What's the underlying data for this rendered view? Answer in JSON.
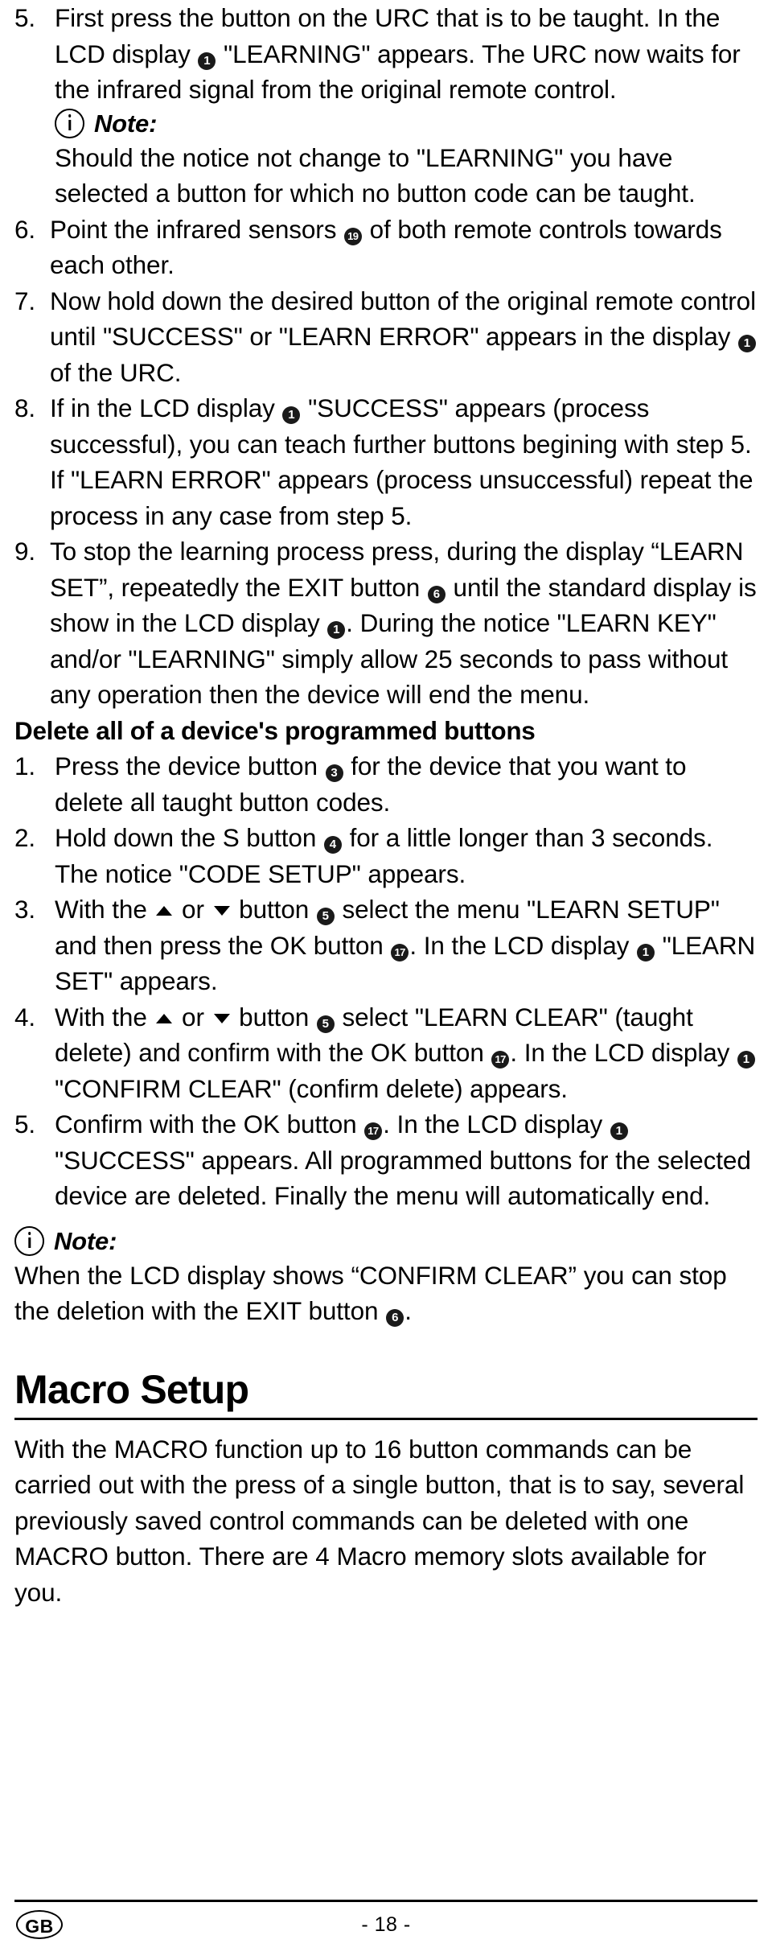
{
  "document": {
    "page_number": "- 18 -",
    "language_badge": "GB"
  },
  "learning_steps": {
    "step5": {
      "number": "5.",
      "text_a": "First press the button on the URC that is to be taught. In the LCD display ",
      "badge_a": "1",
      "text_b": " \"LEARNING\" appears. The URC now waits for the infrared signal from the original remote control."
    },
    "note1": {
      "label": "Note:",
      "body": "Should the notice not change to \"LEARNING\" you have selected a button for which no button code can be taught."
    },
    "step6": {
      "number": "6.",
      "text_a": "Point the infrared sensors ",
      "badge_a": "19",
      "text_b": " of both remote controls towards each other."
    },
    "step7": {
      "number": "7.",
      "text_a": "Now hold down the desired button of the original remote control until \"SUCCESS\" or \"LEARN ERROR\" appears in the display ",
      "badge_a": "1",
      "text_b": " of the URC."
    },
    "step8": {
      "number": "8.",
      "text_a": "If in the LCD display ",
      "badge_a": "1",
      "text_b": " \"SUCCESS\" appears (process successful), you can teach further buttons begining with step 5. If \"LEARN ERROR\" appears (process unsuccessful) repeat the process in any case from step 5."
    },
    "step9": {
      "number": "9.",
      "text_a": "To stop the learning process press, during the display “LEARN SET”, repeatedly the EXIT button ",
      "badge_a": "6",
      "text_b": " until the standard display is show in the LCD display ",
      "badge_b": "1",
      "text_c": ". During the notice \"LEARN KEY\" and/or \"LEARNING\" simply allow 25 seconds to pass without any operation then the device will end the menu."
    }
  },
  "delete_section": {
    "heading": "Delete all of a device's programmed buttons",
    "step1": {
      "number": "1.",
      "text_a": "Press the device button ",
      "badge_a": "3",
      "text_b": " for the device that you want to delete all taught button codes."
    },
    "step2": {
      "number": "2.",
      "text_a": "Hold down the S button ",
      "badge_a": "4",
      "text_b": " for a little longer than 3 seconds. The notice \"CODE SETUP\" appears."
    },
    "step3": {
      "number": "3.",
      "text_a": "With the ",
      "icon_up": "up-arrow",
      "text_b": " or ",
      "icon_down": "down-arrow",
      "text_c": " button ",
      "badge_a": "5",
      "text_d": " select the menu \"LEARN SETUP\" and then press the OK button ",
      "badge_b": "17",
      "text_e": ". In the LCD display ",
      "badge_c": "1",
      "text_f": " \"LEARN SET\" appears."
    },
    "step4": {
      "number": "4.",
      "text_a": "With the ",
      "icon_up": "up-arrow",
      "text_b": " or ",
      "icon_down": "down-arrow",
      "text_c": " button ",
      "badge_a": "5",
      "text_d": " select \"LEARN CLEAR\" (taught delete) and confirm with the OK button ",
      "badge_b": "17",
      "text_e": ". In the LCD display ",
      "badge_c": "1",
      "text_f": " \"CONFIRM CLEAR\" (confirm delete) appears."
    },
    "step5": {
      "number": "5.",
      "text_a": "Confirm with the OK button ",
      "badge_a": "17",
      "text_b": ".  In the LCD display ",
      "badge_b": "1",
      "text_c": " \"SUCCESS\" appears. All programmed buttons for the selected device are deleted. Finally the menu will automatically end."
    },
    "note2": {
      "label": "Note:",
      "text_a": "When the LCD display shows “CONFIRM CLEAR” you can stop the deletion with the EXIT button ",
      "badge_a": "6",
      "text_b": "."
    }
  },
  "macro_section": {
    "title": "Macro Setup",
    "body": "With the MACRO function up to 16 button commands can be carried out with the press of a single button, that is to say, several previously saved control commands can be deleted with one MACRO button. There are 4 Macro memory slots available for you."
  }
}
